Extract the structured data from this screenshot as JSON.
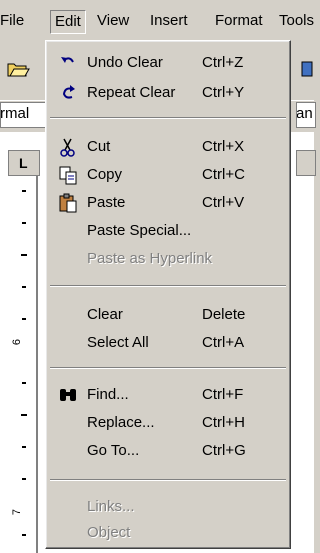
{
  "menubar": {
    "items": [
      {
        "label": "File"
      },
      {
        "label": "Edit"
      },
      {
        "label": "View"
      },
      {
        "label": "Insert"
      },
      {
        "label": "Format"
      },
      {
        "label": "Tools"
      }
    ]
  },
  "formatbar": {
    "style_fragment": "rmal",
    "right_fragment": "an"
  },
  "ruler": {
    "numbers": [
      "6",
      "7"
    ]
  },
  "edit_menu": {
    "groups": [
      [
        {
          "label": "Undo Clear",
          "shortcut": "Ctrl+Z",
          "icon": "undo-icon",
          "enabled": true
        },
        {
          "label": "Repeat Clear",
          "shortcut": "Ctrl+Y",
          "icon": "redo-icon",
          "enabled": true
        }
      ],
      [
        {
          "label": "Cut",
          "shortcut": "Ctrl+X",
          "icon": "scissors-icon",
          "enabled": true
        },
        {
          "label": "Copy",
          "shortcut": "Ctrl+C",
          "icon": "copy-icon",
          "enabled": true
        },
        {
          "label": "Paste",
          "shortcut": "Ctrl+V",
          "icon": "clipboard-icon",
          "enabled": true
        },
        {
          "label": "Paste Special...",
          "shortcut": "",
          "enabled": true
        },
        {
          "label": "Paste as Hyperlink",
          "shortcut": "",
          "enabled": false
        }
      ],
      [
        {
          "label": "Clear",
          "shortcut": "Delete",
          "enabled": true
        },
        {
          "label": "Select All",
          "shortcut": "Ctrl+A",
          "enabled": true
        }
      ],
      [
        {
          "label": "Find...",
          "shortcut": "Ctrl+F",
          "icon": "binoculars-icon",
          "enabled": true
        },
        {
          "label": "Replace...",
          "shortcut": "Ctrl+H",
          "enabled": true
        },
        {
          "label": "Go To...",
          "shortcut": "Ctrl+G",
          "enabled": true
        }
      ],
      [
        {
          "label": "Links...",
          "shortcut": "",
          "enabled": false
        },
        {
          "label": "Object",
          "shortcut": "",
          "enabled": false
        }
      ]
    ]
  },
  "colors": {
    "face": "#d4d0c8",
    "shadow": "#808080",
    "highlight": "#ffffff",
    "disabled_text": "#808080"
  }
}
